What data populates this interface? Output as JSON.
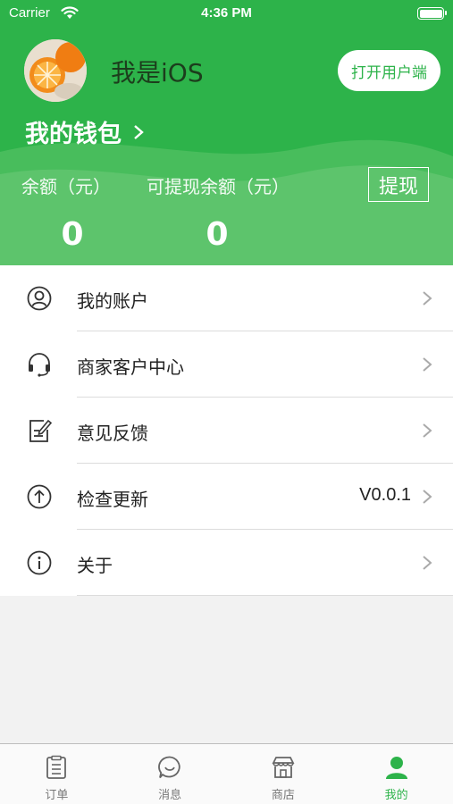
{
  "status_bar": {
    "carrier": "Carrier",
    "time": "4:36 PM"
  },
  "header": {
    "username": "我是iOS",
    "open_user_button": "打开用户端",
    "wallet_link": "我的钱包",
    "balance_label": "余额（元）",
    "withdrawable_label": "可提现余额（元）",
    "withdraw_button": "提现",
    "balance_value": "0",
    "withdrawable_value": "0",
    "accent_color": "#2db34a"
  },
  "menu": {
    "items": [
      {
        "label": "我的账户",
        "icon": "account-icon",
        "value": ""
      },
      {
        "label": "商家客户中心",
        "icon": "headset-icon",
        "value": ""
      },
      {
        "label": "意见反馈",
        "icon": "feedback-icon",
        "value": ""
      },
      {
        "label": "检查更新",
        "icon": "update-icon",
        "value": "V0.0.1"
      },
      {
        "label": "关于",
        "icon": "info-icon",
        "value": ""
      }
    ]
  },
  "tab_bar": {
    "tabs": [
      {
        "label": "订单",
        "icon": "order-icon",
        "active": false
      },
      {
        "label": "消息",
        "icon": "message-icon",
        "active": false
      },
      {
        "label": "商店",
        "icon": "store-icon",
        "active": false
      },
      {
        "label": "我的",
        "icon": "profile-icon",
        "active": true
      }
    ]
  }
}
